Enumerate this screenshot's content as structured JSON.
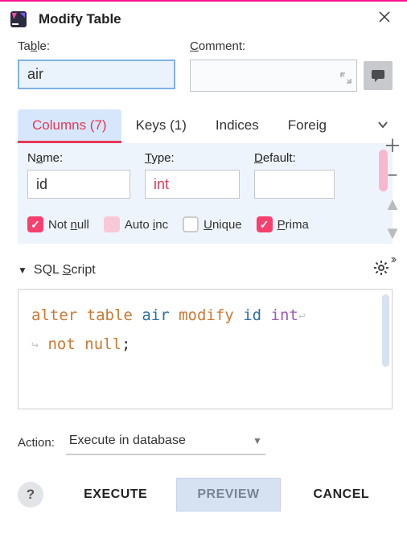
{
  "dialog": {
    "title": "Modify Table",
    "app_icon_label": "intellij-icon"
  },
  "fields": {
    "table_label_pre": "Ta",
    "table_label_ul": "b",
    "table_label_post": "le:",
    "table_value": "air",
    "comment_label_ul": "C",
    "comment_label_post": "omment:",
    "comment_value": ""
  },
  "tabs": [
    {
      "label": "Columns (7)",
      "active": true
    },
    {
      "label": "Keys (1)",
      "active": false
    },
    {
      "label": "Indices",
      "active": false
    },
    {
      "label": "Foreig",
      "active": false
    }
  ],
  "column_panel": {
    "headers": {
      "name_pre": "N",
      "name_ul": "a",
      "name_post": "me:",
      "type_ul": "T",
      "type_post": "ype:",
      "default_ul": "D",
      "default_post": "efault:"
    },
    "values": {
      "name": "id",
      "type": "int",
      "default": ""
    },
    "checks": {
      "not_null": {
        "checked": true,
        "pre": "Not ",
        "ul": "n",
        "post": "ull"
      },
      "auto_inc": {
        "checked": false,
        "disabled": true,
        "pre": "Auto ",
        "ul": "i",
        "post": "nc"
      },
      "unique": {
        "checked": false,
        "ul": "U",
        "post": "nique"
      },
      "primary": {
        "checked": true,
        "ul": "P",
        "post": "rima"
      }
    }
  },
  "script": {
    "header_pre": "SQL ",
    "header_ul": "S",
    "header_post": "cript",
    "tokens": {
      "t1": "alter",
      "t2": "table",
      "t3": "air",
      "t4": "modify",
      "t5": "id",
      "t6": "int",
      "t7": "not",
      "t8": "null",
      "t9": ";"
    }
  },
  "action": {
    "label": "Action:",
    "selected": "Execute in database"
  },
  "buttons": {
    "help": "?",
    "execute": "EXECUTE",
    "preview": "PREVIEW",
    "cancel": "CANCEL"
  }
}
